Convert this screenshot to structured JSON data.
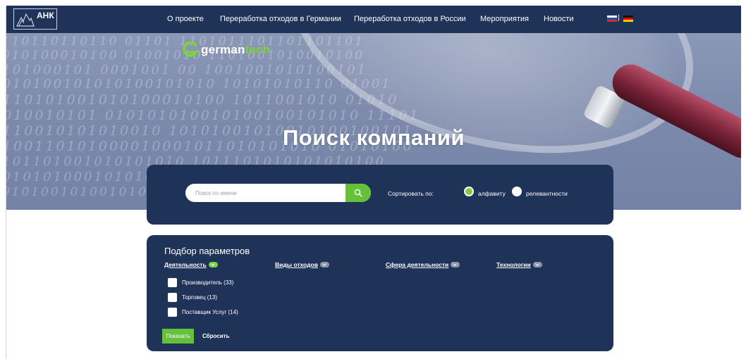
{
  "brand": {
    "logo_text": "АНК",
    "partner": {
      "part1": "german",
      "part2": "tech"
    }
  },
  "colors": {
    "navy": "#1f3358",
    "accent_green": "#65c13a",
    "hero_tint": "#7d8aac"
  },
  "nav": {
    "items": [
      "О проекте",
      "Переработка отходов в Германии",
      "Переработка отходов в России",
      "Мероприятия",
      "Новости"
    ]
  },
  "lang": {
    "flags": [
      "ru-flag-icon",
      "de-flag-icon"
    ]
  },
  "hero": {
    "title": "Поиск компаний",
    "binary_rows": [
      "0110110110110 01101 1101011101101101101",
      "0010100010100 01001010 1101001010010100",
      "0101000101 0001001 00 1001001010100101",
      "1010100101010100101010 10101010110 01001",
      "0110101001010100010100 1011001010 01010",
      "1010010101 010101010010100100101010 11101",
      "0110010101010010 10101001010010100100101",
      "1100110101000010001011010101010 01010100",
      "0101101001010101010 1011101010101010100",
      "1010101000101010010 01100010010100101010",
      "0010100101001010010100101001010 10101001"
    ]
  },
  "search": {
    "placeholder": "Поиск по имени",
    "sort_label": "Сортировать по:",
    "sort_options": [
      "алфавиту",
      "релевантности"
    ],
    "selected_sort": "алфавиту"
  },
  "filters": {
    "title": "Подбор параметров",
    "categories": [
      "Деятельность",
      "Виды отходов",
      "Сфера деятельности",
      "Технологии"
    ],
    "active_category": "Деятельность",
    "options": [
      "Производитель (33)",
      "Торговец (13)",
      "Поставщик Услуг (14)"
    ],
    "show_label": "Показать",
    "reset_label": "Сбросить"
  }
}
